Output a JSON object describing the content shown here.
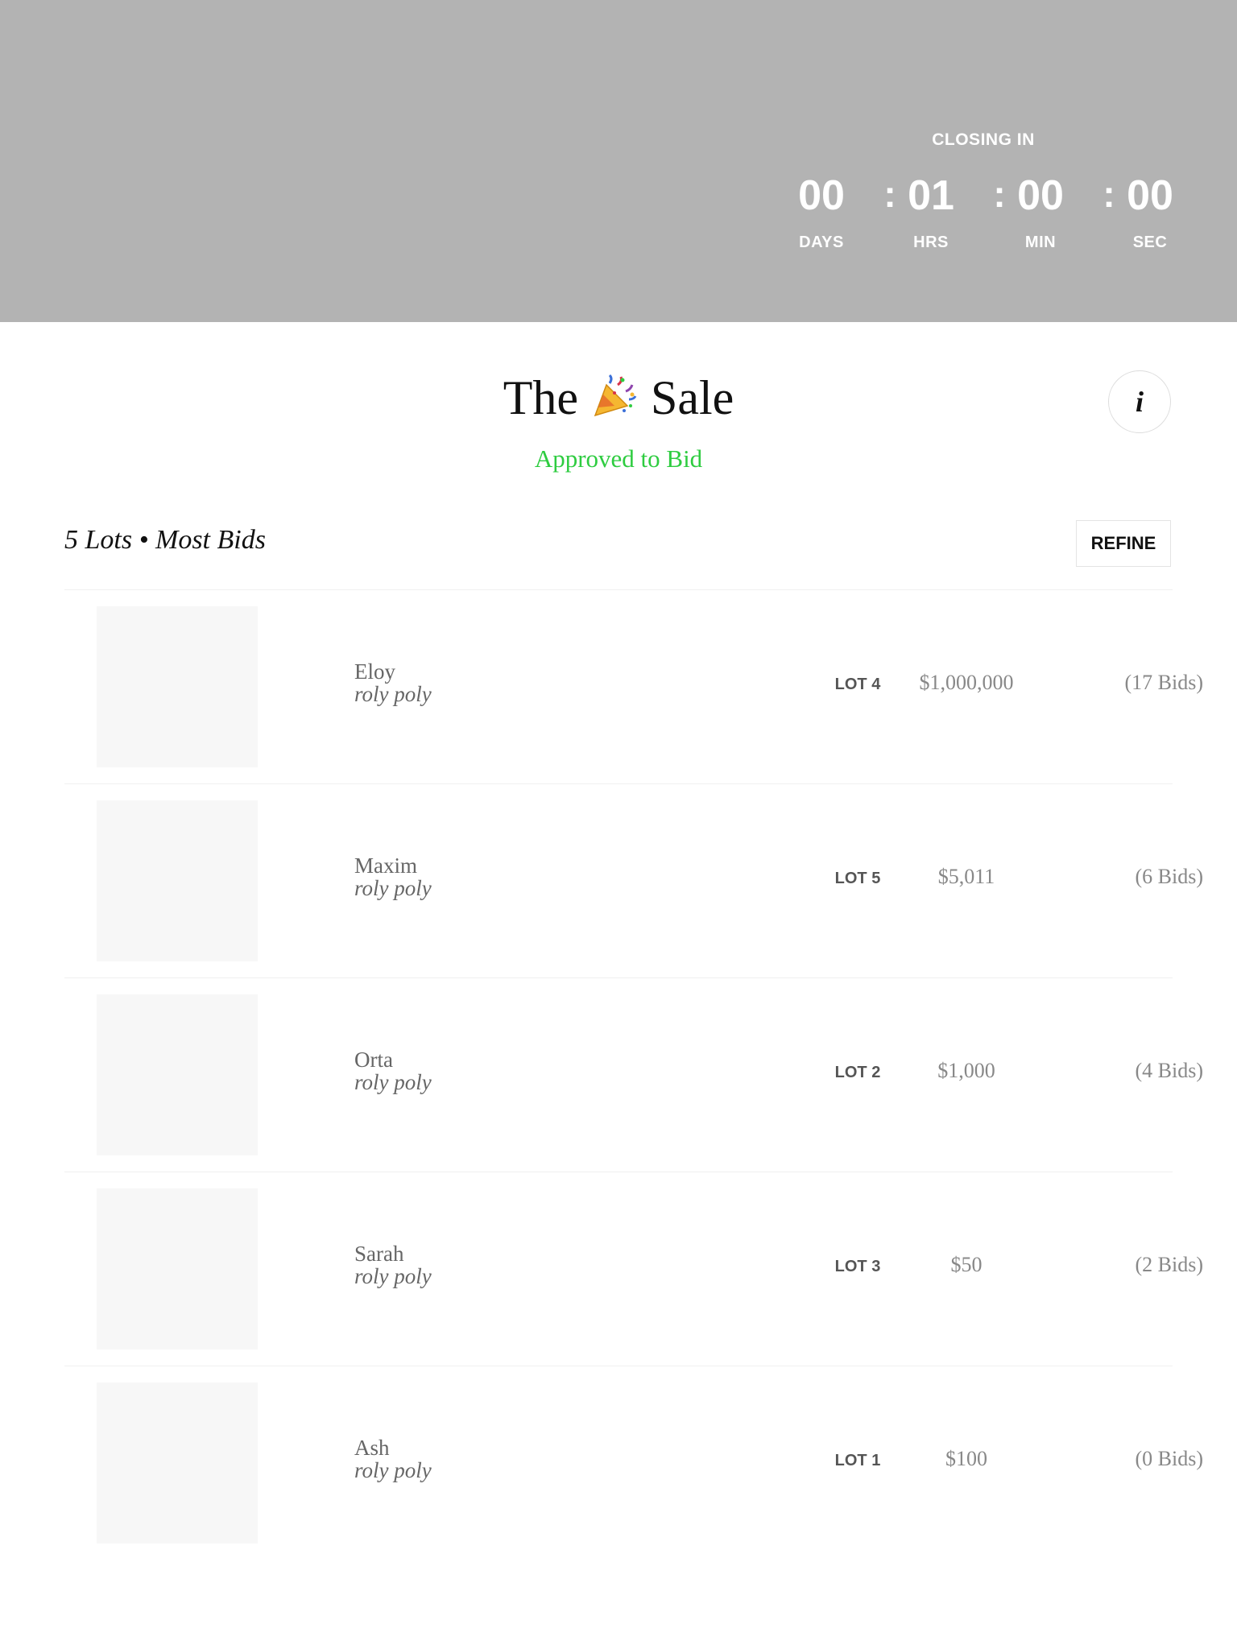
{
  "countdown": {
    "title": "CLOSING IN",
    "days": "00",
    "hours": "01",
    "minutes": "00",
    "seconds": "00",
    "separator": ":",
    "days_label": "DAYS",
    "hours_label": "HRS",
    "minutes_label": "MIN",
    "seconds_label": "SEC"
  },
  "sale": {
    "title_before": "The",
    "title_after": "Sale",
    "title_icon": "party-popper-icon",
    "status": "Approved to Bid",
    "status_color": "#2ecc40",
    "info_label": "i"
  },
  "filter": {
    "summary": "5 Lots • Most Bids",
    "refine_label": "REFINE"
  },
  "lots": [
    {
      "artist": "Eloy",
      "title": "roly poly",
      "lot": "LOT 4",
      "price": "$1,000,000",
      "bids": "(17 Bids)"
    },
    {
      "artist": "Maxim",
      "title": "roly poly",
      "lot": "LOT 5",
      "price": "$5,011",
      "bids": "(6 Bids)"
    },
    {
      "artist": "Orta",
      "title": "roly poly",
      "lot": "LOT 2",
      "price": "$1,000",
      "bids": "(4 Bids)"
    },
    {
      "artist": "Sarah",
      "title": "roly poly",
      "lot": "LOT 3",
      "price": "$50",
      "bids": "(2 Bids)"
    },
    {
      "artist": "Ash",
      "title": "roly poly",
      "lot": "LOT 1",
      "price": "$100",
      "bids": "(0 Bids)"
    }
  ]
}
